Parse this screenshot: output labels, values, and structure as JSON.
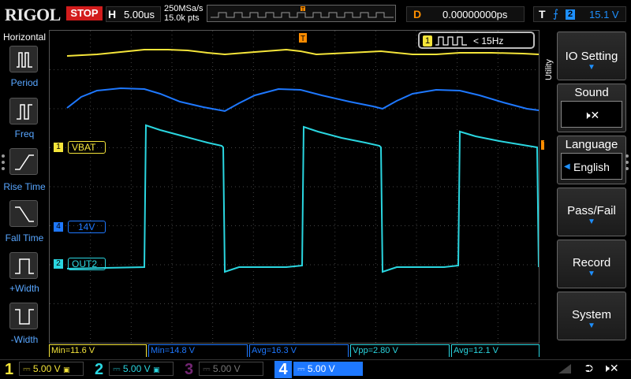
{
  "top": {
    "brand": "RIGOL",
    "run_state": "STOP",
    "horizontal_label": "H",
    "timebase": "5.00us",
    "sample_rate": "250MSa/s",
    "points": "15.0k pts",
    "trigger_pos_label": "T",
    "delay_label": "D",
    "delay_value": "0.00000000ps",
    "trigger_label": "T",
    "trigger_edge": "⨍",
    "trigger_source": "2",
    "trigger_level": "15.1 V"
  },
  "left_panel": {
    "title": "Horizontal",
    "items": [
      {
        "label": "Period",
        "icon": "period-icon"
      },
      {
        "label": "Freq",
        "icon": "freq-icon"
      },
      {
        "label": "Rise Time",
        "icon": "rise-time-icon"
      },
      {
        "label": "Fall Time",
        "icon": "fall-time-icon"
      },
      {
        "label": "+Width",
        "icon": "positive-width-icon"
      },
      {
        "label": "-Width",
        "icon": "negative-width-icon"
      }
    ]
  },
  "waveform": {
    "trigger_marker": "T",
    "freq_counter_channel": "1",
    "freq_counter_value": "< 15Hz",
    "channel_labels": [
      {
        "num": "1",
        "text": "VBAT",
        "color": "#f5e53a"
      },
      {
        "num": "4",
        "text": "14V",
        "color": "#1e78ff"
      },
      {
        "num": "2",
        "text": "OUT2",
        "color": "#2ad6e0"
      }
    ],
    "trigger_level_marker": "T"
  },
  "right_panel": {
    "utility": "Utility",
    "items": [
      {
        "label": "IO Setting"
      },
      {
        "label": "Sound",
        "value_icon": "speaker-mute-icon"
      },
      {
        "label": "Language",
        "value": "English"
      },
      {
        "label": "Pass/Fail"
      },
      {
        "label": "Record"
      },
      {
        "label": "System"
      }
    ]
  },
  "measurements": [
    {
      "text": "Min=11.6 V",
      "color": "#f5e53a"
    },
    {
      "text": "Min=14.8 V",
      "color": "#1e78ff"
    },
    {
      "text": "Avg=16.3 V",
      "color": "#1e78ff"
    },
    {
      "text": "Vpp=2.80 V",
      "color": "#2ad6e0"
    },
    {
      "text": "Avg=12.1 V",
      "color": "#2ad6e0"
    }
  ],
  "channels": [
    {
      "num": "1",
      "scale": "5.00 V",
      "color": "#f5e53a"
    },
    {
      "num": "2",
      "scale": "5.00 V",
      "color": "#2ad6e0"
    },
    {
      "num": "3",
      "scale": "5.00 V",
      "color": "#c040c0"
    },
    {
      "num": "4",
      "scale": "5.00 V",
      "color": "#1e78ff"
    }
  ],
  "colors": {
    "ch1": "#f5e53a",
    "ch2": "#2ad6e0",
    "ch3": "#c040c0",
    "ch4": "#1e78ff",
    "stop": "#d21c1c",
    "accent": "#1e90ff"
  }
}
